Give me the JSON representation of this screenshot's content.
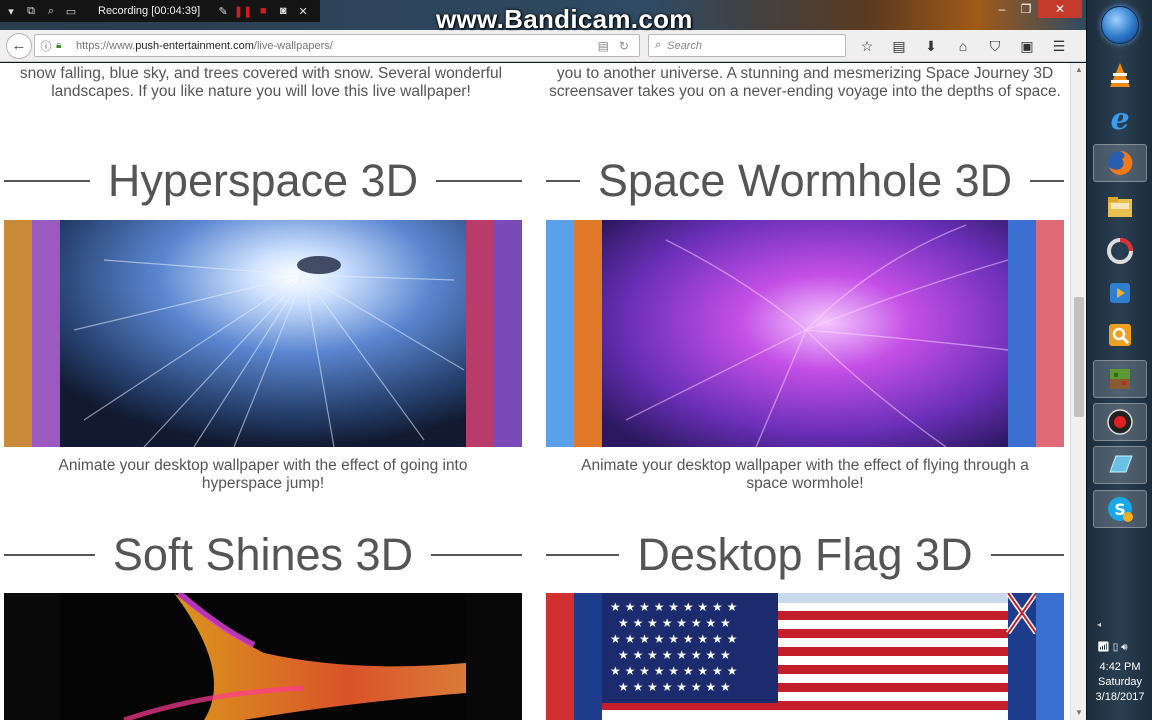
{
  "recorder": {
    "status": "Recording [00:04:39]",
    "watermark": "www.Bandicam.com"
  },
  "browser": {
    "url_prefix": "https://www.",
    "url_domain": "push-entertainment.com",
    "url_path": "/live-wallpapers/",
    "search_placeholder": "Search"
  },
  "page": {
    "top_left_text": "snow falling, blue sky, and trees covered with snow. Several wonderful landscapes. If you like nature you will love this live wallpaper!",
    "top_right_text": "you to another universe. A stunning and mesmerizing Space Journey 3D screensaver takes you on a never-ending voyage into the depths of space.",
    "items": [
      {
        "title": "Hyperspace 3D",
        "description": "Animate your desktop wallpaper with the effect of going into hyperspace jump!"
      },
      {
        "title": "Space Wormhole 3D",
        "description": "Animate your desktop wallpaper with the effect of flying through a space wormhole!"
      },
      {
        "title": "Soft Shines 3D",
        "description": ""
      },
      {
        "title": "Desktop Flag 3D",
        "description": ""
      }
    ]
  },
  "taskbar": {
    "time": "4:42 PM",
    "day": "Saturday",
    "date": "3/18/2017"
  }
}
